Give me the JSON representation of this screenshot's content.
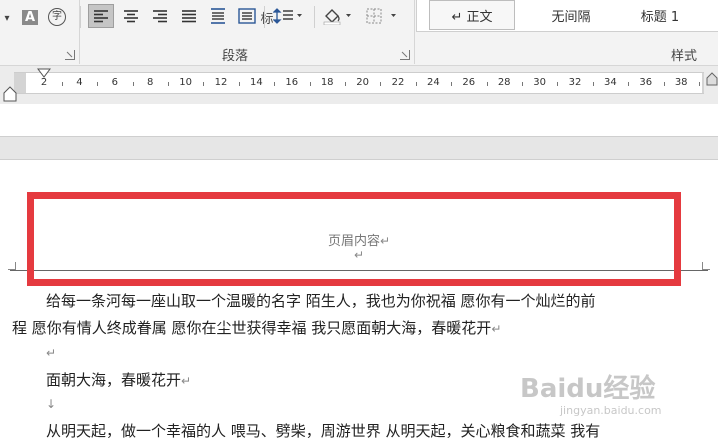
{
  "ribbon": {
    "font_buttons": [
      {
        "name": "clear-format-icon",
        "glyph": "A"
      },
      {
        "name": "phonetic-guide-icon",
        "glyph": "字"
      }
    ],
    "paragraph_label": "段落",
    "styles_label": "样式",
    "cut_text": "标",
    "styles": [
      {
        "label": "↵ 正文",
        "selected": true
      },
      {
        "label": "无间隔",
        "selected": false
      },
      {
        "label": "标题 1",
        "selected": false
      }
    ]
  },
  "ruler": {
    "numbers": [
      "2",
      "4",
      "6",
      "8",
      "10",
      "12",
      "14",
      "16",
      "18",
      "20",
      "22",
      "24",
      "26",
      "28",
      "30",
      "32",
      "34",
      "36",
      "38"
    ]
  },
  "document": {
    "header_content": "页眉内容",
    "header_mark": "↵",
    "header_empty_mark": "↵",
    "lines": [
      {
        "text": "给每一条河每一座山取一个温暖的名字  陌生人，我也为你祝福  愿你有一个灿烂的前",
        "mark": ""
      },
      {
        "text": "程  愿你有情人终成眷属  愿你在尘世获得幸福  我只愿面朝大海，春暖花开",
        "mark": "↵"
      },
      {
        "text": "",
        "mark": "↵"
      },
      {
        "text": "面朝大海，春暖花开",
        "mark": "↵"
      },
      {
        "text": "",
        "mark": "↓"
      },
      {
        "text": "从明天起，做一个幸福的人  喂马、劈柴，周游世界  从明天起，关心粮食和蔬菜  我有",
        "mark": ""
      }
    ]
  },
  "watermark": {
    "brand": "Baidu经验",
    "url": "jingyan.baidu.com"
  },
  "colors": {
    "highlight": "#e53a3f",
    "ribbon": "#f3f3f3"
  }
}
